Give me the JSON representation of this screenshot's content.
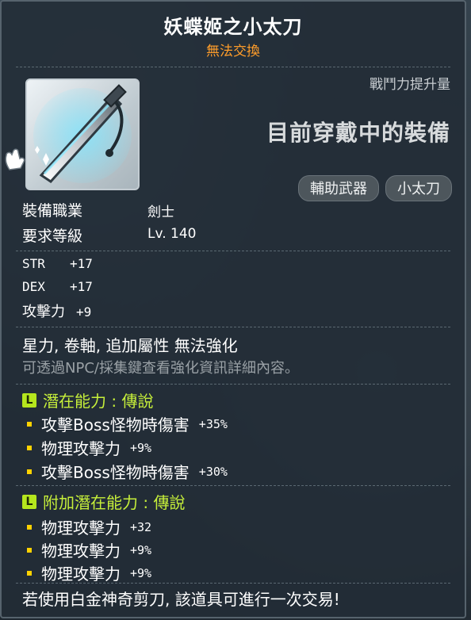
{
  "item": {
    "name": "妖蝶姬之小太刀",
    "trade_status": "無法交換",
    "stat_header": "戰鬥力提升量",
    "equip_status": "目前穿戴中的裝備",
    "tags": [
      "輔助武器",
      "小太刀"
    ],
    "icon": "kodachi-weapon-icon"
  },
  "requirements": {
    "job_label": "裝備職業",
    "job_value": "劍士",
    "level_label": "要求等級",
    "level_value": "Lv. 140"
  },
  "stats": [
    {
      "name": "STR",
      "value": "+17"
    },
    {
      "name": "DEX",
      "value": "+17"
    },
    {
      "name": "攻擊力",
      "value": "+9"
    }
  ],
  "notes": {
    "enhance": "星力, 卷軸, 追加屬性 無法強化",
    "hint": "可透過NPC/採集鍵查看強化資訊詳細內容。"
  },
  "potential": {
    "title": "潛在能力 : 傳說",
    "lines": [
      {
        "name": "攻擊Boss怪物時傷害",
        "value": "+35%"
      },
      {
        "name": "物理攻擊力",
        "value": "+9%"
      },
      {
        "name": "攻擊Boss怪物時傷害",
        "value": "+30%"
      }
    ]
  },
  "additional_potential": {
    "title": "附加潛在能力 : 傳說",
    "lines": [
      {
        "name": "物理攻擊力",
        "value": "+32"
      },
      {
        "name": "物理攻擊力",
        "value": "+9%"
      },
      {
        "name": "物理攻擊力",
        "value": "+9%"
      }
    ]
  },
  "footer": "若使用白金神奇剪刀, 該道具可進行一次交易!",
  "colors": {
    "title": "#ffffff",
    "trade_status": "#ff9d2a",
    "potential_label": "#c6ef3a",
    "bullet": "#ffd200"
  }
}
